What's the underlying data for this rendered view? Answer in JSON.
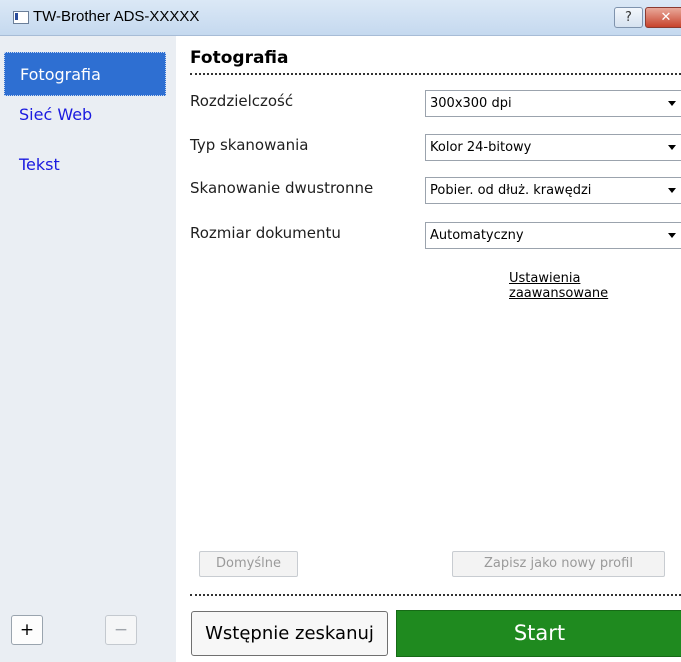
{
  "window": {
    "title": "TW-Brother ADS-XXXXX",
    "help_label": "?",
    "close_label": "✕"
  },
  "sidebar": {
    "items": [
      {
        "label": "Fotografia",
        "active": true
      },
      {
        "label": "Sieć Web",
        "active": false
      },
      {
        "label": "Tekst",
        "active": false
      }
    ],
    "add_label": "+",
    "remove_label": "−"
  },
  "main": {
    "title": "Fotografia",
    "settings": [
      {
        "label": "Rozdzielczość",
        "value": "300x300 dpi"
      },
      {
        "label": "Typ skanowania",
        "value": "Kolor 24-bitowy"
      },
      {
        "label": "Skanowanie dwustronne",
        "value": "Pobier. od dłuż. krawędzi"
      },
      {
        "label": "Rozmiar dokumentu",
        "value": "Automatyczny"
      }
    ],
    "advanced_link": "Ustawienia zaawansowane",
    "default_button": "Domyślne",
    "save_profile_button": "Zapisz jako nowy profil"
  },
  "footer": {
    "prescan_button": "Wstępnie zeskanuj",
    "start_button": "Start"
  },
  "colors": {
    "accent": "#2e6fd2",
    "start": "#1f8a1f",
    "link": "#1a1ae0"
  }
}
